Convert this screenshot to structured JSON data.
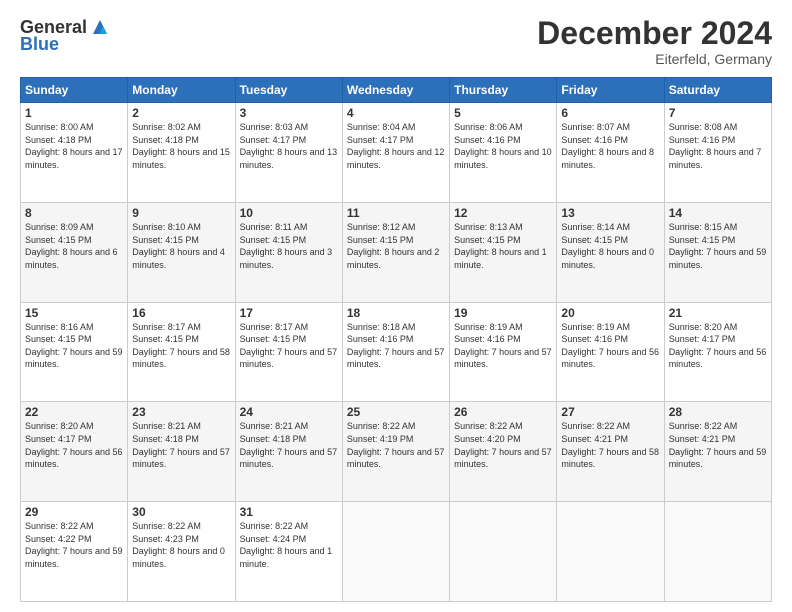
{
  "header": {
    "logo_line1": "General",
    "logo_line2": "Blue",
    "month_title": "December 2024",
    "location": "Eiterfeld, Germany"
  },
  "weekdays": [
    "Sunday",
    "Monday",
    "Tuesday",
    "Wednesday",
    "Thursday",
    "Friday",
    "Saturday"
  ],
  "weeks": [
    [
      {
        "day": "1",
        "info": "Sunrise: 8:00 AM\nSunset: 4:18 PM\nDaylight: 8 hours and 17 minutes."
      },
      {
        "day": "2",
        "info": "Sunrise: 8:02 AM\nSunset: 4:18 PM\nDaylight: 8 hours and 15 minutes."
      },
      {
        "day": "3",
        "info": "Sunrise: 8:03 AM\nSunset: 4:17 PM\nDaylight: 8 hours and 13 minutes."
      },
      {
        "day": "4",
        "info": "Sunrise: 8:04 AM\nSunset: 4:17 PM\nDaylight: 8 hours and 12 minutes."
      },
      {
        "day": "5",
        "info": "Sunrise: 8:06 AM\nSunset: 4:16 PM\nDaylight: 8 hours and 10 minutes."
      },
      {
        "day": "6",
        "info": "Sunrise: 8:07 AM\nSunset: 4:16 PM\nDaylight: 8 hours and 8 minutes."
      },
      {
        "day": "7",
        "info": "Sunrise: 8:08 AM\nSunset: 4:16 PM\nDaylight: 8 hours and 7 minutes."
      }
    ],
    [
      {
        "day": "8",
        "info": "Sunrise: 8:09 AM\nSunset: 4:15 PM\nDaylight: 8 hours and 6 minutes."
      },
      {
        "day": "9",
        "info": "Sunrise: 8:10 AM\nSunset: 4:15 PM\nDaylight: 8 hours and 4 minutes."
      },
      {
        "day": "10",
        "info": "Sunrise: 8:11 AM\nSunset: 4:15 PM\nDaylight: 8 hours and 3 minutes."
      },
      {
        "day": "11",
        "info": "Sunrise: 8:12 AM\nSunset: 4:15 PM\nDaylight: 8 hours and 2 minutes."
      },
      {
        "day": "12",
        "info": "Sunrise: 8:13 AM\nSunset: 4:15 PM\nDaylight: 8 hours and 1 minute."
      },
      {
        "day": "13",
        "info": "Sunrise: 8:14 AM\nSunset: 4:15 PM\nDaylight: 8 hours and 0 minutes."
      },
      {
        "day": "14",
        "info": "Sunrise: 8:15 AM\nSunset: 4:15 PM\nDaylight: 7 hours and 59 minutes."
      }
    ],
    [
      {
        "day": "15",
        "info": "Sunrise: 8:16 AM\nSunset: 4:15 PM\nDaylight: 7 hours and 59 minutes."
      },
      {
        "day": "16",
        "info": "Sunrise: 8:17 AM\nSunset: 4:15 PM\nDaylight: 7 hours and 58 minutes."
      },
      {
        "day": "17",
        "info": "Sunrise: 8:17 AM\nSunset: 4:15 PM\nDaylight: 7 hours and 57 minutes."
      },
      {
        "day": "18",
        "info": "Sunrise: 8:18 AM\nSunset: 4:16 PM\nDaylight: 7 hours and 57 minutes."
      },
      {
        "day": "19",
        "info": "Sunrise: 8:19 AM\nSunset: 4:16 PM\nDaylight: 7 hours and 57 minutes."
      },
      {
        "day": "20",
        "info": "Sunrise: 8:19 AM\nSunset: 4:16 PM\nDaylight: 7 hours and 56 minutes."
      },
      {
        "day": "21",
        "info": "Sunrise: 8:20 AM\nSunset: 4:17 PM\nDaylight: 7 hours and 56 minutes."
      }
    ],
    [
      {
        "day": "22",
        "info": "Sunrise: 8:20 AM\nSunset: 4:17 PM\nDaylight: 7 hours and 56 minutes."
      },
      {
        "day": "23",
        "info": "Sunrise: 8:21 AM\nSunset: 4:18 PM\nDaylight: 7 hours and 57 minutes."
      },
      {
        "day": "24",
        "info": "Sunrise: 8:21 AM\nSunset: 4:18 PM\nDaylight: 7 hours and 57 minutes."
      },
      {
        "day": "25",
        "info": "Sunrise: 8:22 AM\nSunset: 4:19 PM\nDaylight: 7 hours and 57 minutes."
      },
      {
        "day": "26",
        "info": "Sunrise: 8:22 AM\nSunset: 4:20 PM\nDaylight: 7 hours and 57 minutes."
      },
      {
        "day": "27",
        "info": "Sunrise: 8:22 AM\nSunset: 4:21 PM\nDaylight: 7 hours and 58 minutes."
      },
      {
        "day": "28",
        "info": "Sunrise: 8:22 AM\nSunset: 4:21 PM\nDaylight: 7 hours and 59 minutes."
      }
    ],
    [
      {
        "day": "29",
        "info": "Sunrise: 8:22 AM\nSunset: 4:22 PM\nDaylight: 7 hours and 59 minutes."
      },
      {
        "day": "30",
        "info": "Sunrise: 8:22 AM\nSunset: 4:23 PM\nDaylight: 8 hours and 0 minutes."
      },
      {
        "day": "31",
        "info": "Sunrise: 8:22 AM\nSunset: 4:24 PM\nDaylight: 8 hours and 1 minute."
      },
      null,
      null,
      null,
      null
    ]
  ]
}
